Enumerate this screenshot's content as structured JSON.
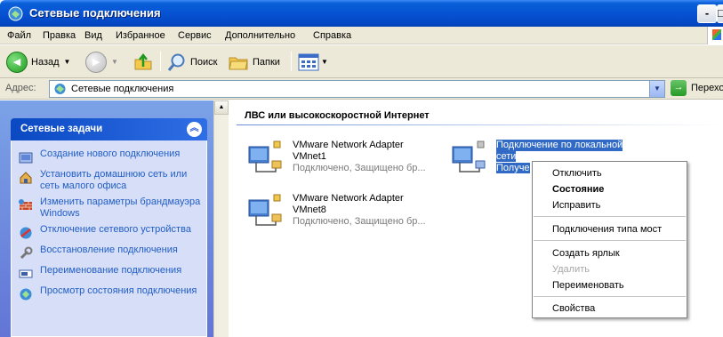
{
  "window": {
    "title": "Сетевые подключения"
  },
  "menu": {
    "items": [
      "Файл",
      "Правка",
      "Вид",
      "Избранное",
      "Сервис",
      "Дополнительно",
      "Справка"
    ]
  },
  "toolbar": {
    "back_label": "Назад",
    "search_label": "Поиск",
    "folders_label": "Папки"
  },
  "address": {
    "label": "Адрес:",
    "value": "Сетевые подключения",
    "go_label": "Перехо"
  },
  "tasks": {
    "header": "Сетевые задачи",
    "items": [
      {
        "label": "Создание нового подключения",
        "icon": "new-connection-icon"
      },
      {
        "label": "Установить домашнюю сеть или сеть малого офиса",
        "icon": "home-network-icon"
      },
      {
        "label": "Изменить параметры брандмауэра Windows",
        "icon": "firewall-icon"
      },
      {
        "label": "Отключение сетевого устройства",
        "icon": "disable-device-icon"
      },
      {
        "label": "Восстановление подключения",
        "icon": "repair-icon"
      },
      {
        "label": "Переименование подключения",
        "icon": "rename-icon"
      },
      {
        "label": "Просмотр состояния подключения",
        "icon": "status-icon"
      }
    ]
  },
  "content": {
    "group_header": "ЛВС или высокоскоростной Интернет",
    "connections": [
      {
        "line1": "VMware Network Adapter",
        "line2": "VMnet1",
        "status": "Подключено, Защищено бр..."
      },
      {
        "line1": "Подключение по локальной",
        "line2": "сети",
        "status": "Получе"
      },
      {
        "line1": "VMware Network Adapter",
        "line2": "VMnet8",
        "status": "Подключено, Защищено бр..."
      }
    ]
  },
  "context_menu": {
    "disconnect": "Отключить",
    "status": "Состояние",
    "repair": "Исправить",
    "bridge": "Подключения типа мост",
    "shortcut": "Создать ярлык",
    "delete": "Удалить",
    "rename": "Переименовать",
    "properties": "Свойства"
  },
  "colors": {
    "titlebar": "#0653d3",
    "taskpane": "#6e8fe0",
    "link": "#215dc6",
    "selection": "#316ac5"
  }
}
